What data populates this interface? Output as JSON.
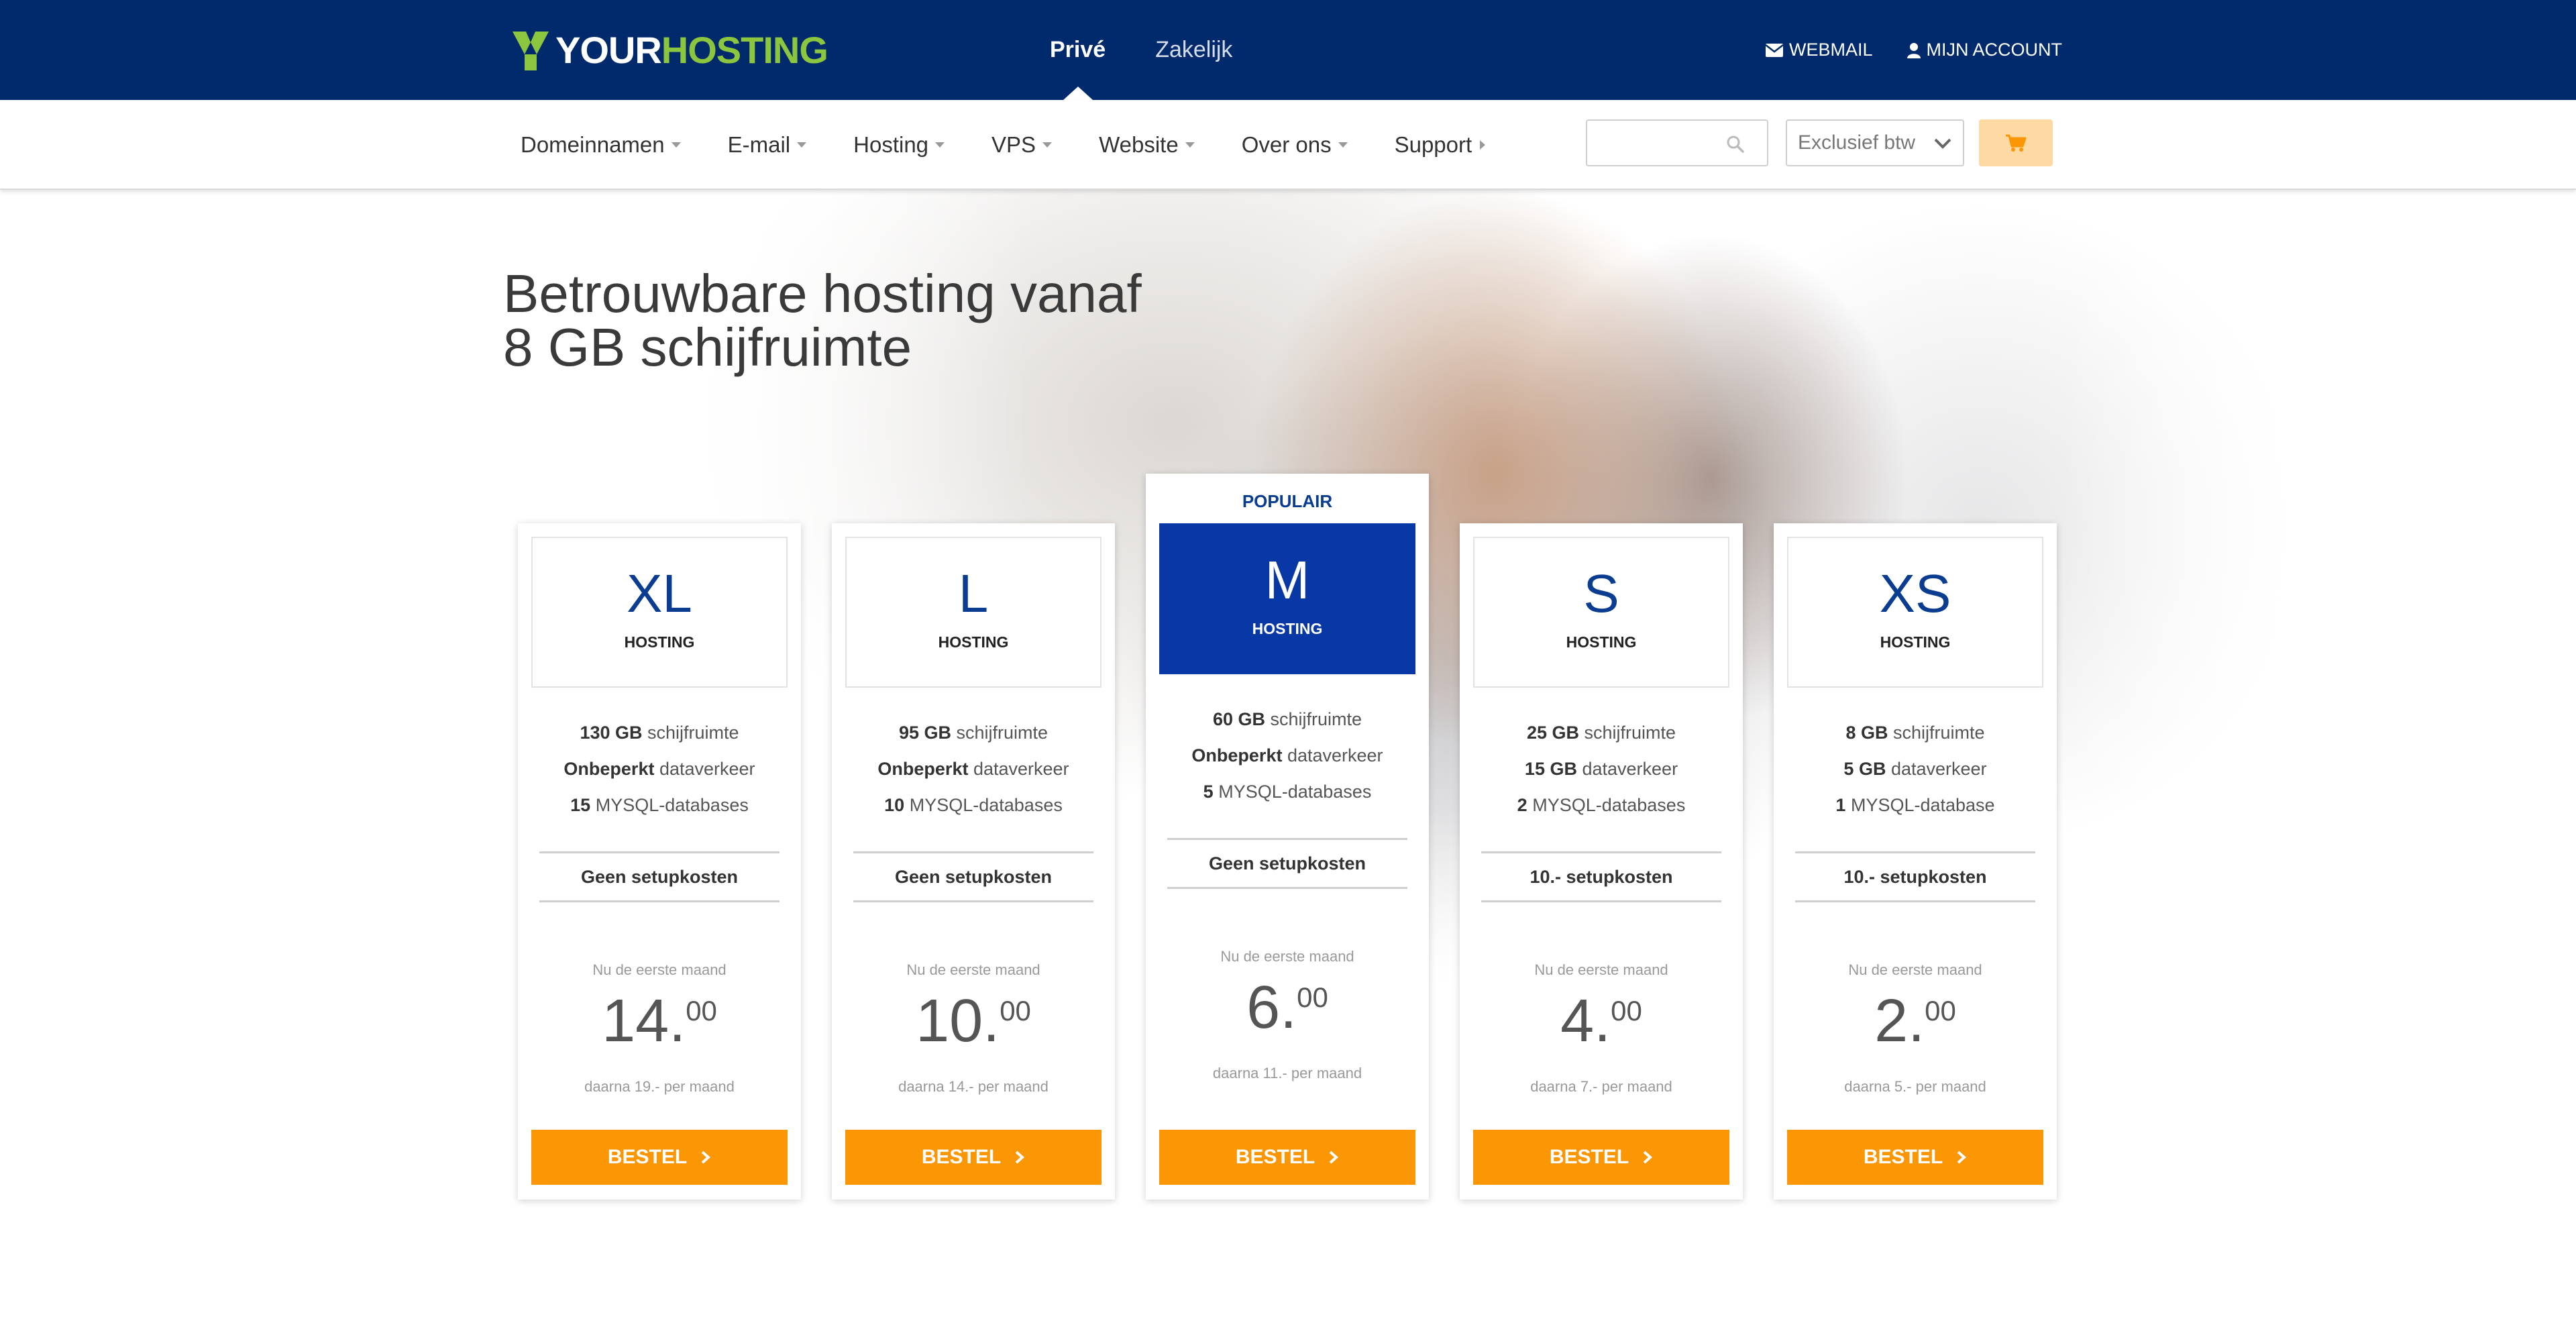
{
  "header": {
    "logo_your": "YOUR",
    "logo_hosting": "HOSTING",
    "segments": [
      {
        "label": "Privé",
        "active": true
      },
      {
        "label": "Zakelijk",
        "active": false
      }
    ],
    "webmail": "WEBMAIL",
    "account": "MIJN ACCOUNT"
  },
  "menu": {
    "items": [
      "Domeinnamen",
      "E-mail",
      "Hosting",
      "VPS",
      "Website",
      "Over ons",
      "Support"
    ],
    "search_placeholder": "",
    "vat_select": "Exclusief btw",
    "icons": [
      "search-icon",
      "chevron-down-icon",
      "cart-icon",
      "envelope-icon",
      "user-icon"
    ]
  },
  "hero": {
    "line1": "Betrouwbare hosting vanaf",
    "line2": "8 GB schijfruimte"
  },
  "colors": {
    "header_bg": "#002a6c",
    "logo_green": "#8cc63f",
    "accent_blue": "#0838a5",
    "button_orange": "#fb9605",
    "cart_bg": "#fdd9a3"
  },
  "plans": [
    {
      "size": "XL",
      "type": "HOSTING",
      "f1_b": "130 GB",
      "f1_t": "schijfruimte",
      "f2_b": "Onbeperkt",
      "f2_t": "dataverkeer",
      "f3_b": "15",
      "f3_t": "MYSQL-databases",
      "setup": "Geen setupkosten",
      "note": "Nu de eerste maand",
      "price_int": "14.",
      "price_dec": "00",
      "after": "daarna 19.- per maand",
      "cta": "BESTEL"
    },
    {
      "size": "L",
      "type": "HOSTING",
      "f1_b": "95 GB",
      "f1_t": "schijfruimte",
      "f2_b": "Onbeperkt",
      "f2_t": "dataverkeer",
      "f3_b": "10",
      "f3_t": "MYSQL-databases",
      "setup": "Geen setupkosten",
      "note": "Nu de eerste maand",
      "price_int": "10.",
      "price_dec": "00",
      "after": "daarna 14.- per maand",
      "cta": "BESTEL"
    },
    {
      "badge": "POPULAIR",
      "size": "M",
      "type": "HOSTING",
      "f1_b": "60 GB",
      "f1_t": "schijfruimte",
      "f2_b": "Onbeperkt",
      "f2_t": "dataverkeer",
      "f3_b": "5",
      "f3_t": "MYSQL-databases",
      "setup": "Geen setupkosten",
      "note": "Nu de eerste maand",
      "price_int": "6.",
      "price_dec": "00",
      "after": "daarna 11.- per maand",
      "cta": "BESTEL"
    },
    {
      "size": "S",
      "type": "HOSTING",
      "f1_b": "25 GB",
      "f1_t": "schijfruimte",
      "f2_b": "15 GB",
      "f2_t": "dataverkeer",
      "f3_b": "2",
      "f3_t": "MYSQL-databases",
      "setup": "10.- setupkosten",
      "note": "Nu de eerste maand",
      "price_int": "4.",
      "price_dec": "00",
      "after": "daarna 7.- per maand",
      "cta": "BESTEL"
    },
    {
      "size": "XS",
      "type": "HOSTING",
      "f1_b": "8 GB",
      "f1_t": "schijfruimte",
      "f2_b": "5 GB",
      "f2_t": "dataverkeer",
      "f3_b": "1",
      "f3_t": "MYSQL-database",
      "setup": "10.- setupkosten",
      "note": "Nu de eerste maand",
      "price_int": "2.",
      "price_dec": "00",
      "after": "daarna 5.- per maand",
      "cta": "BESTEL"
    }
  ]
}
